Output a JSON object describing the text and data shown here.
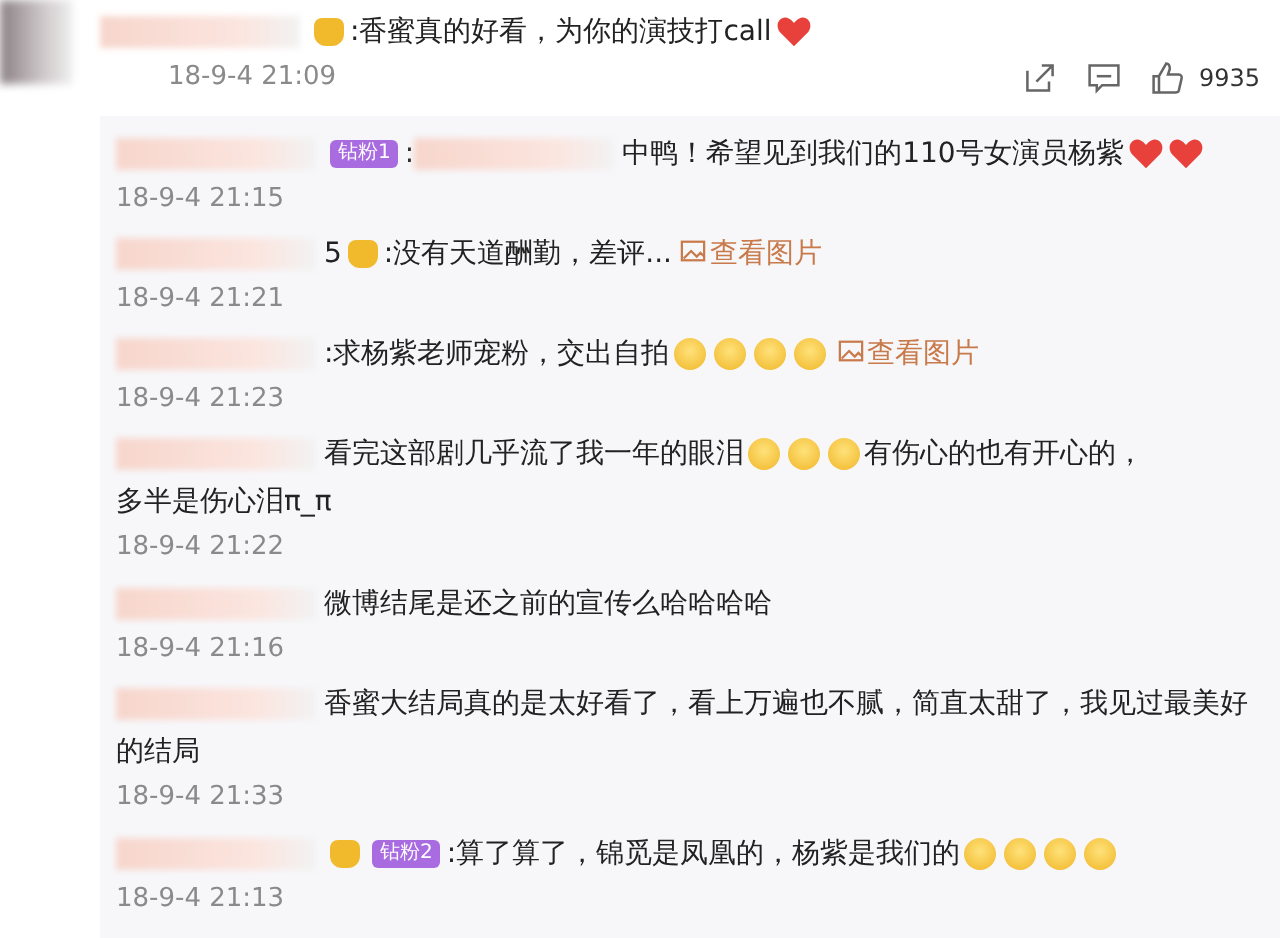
{
  "comment": {
    "segments": [
      {
        "kind": "name"
      },
      {
        "kind": "vip"
      },
      {
        "kind": "text",
        "text": ":香蜜真的好看，为你的演技打call"
      },
      {
        "kind": "heart"
      }
    ],
    "time": "18-9-4 21:09",
    "likes": "9935"
  },
  "replies": [
    {
      "segments": [
        {
          "kind": "name"
        },
        {
          "kind": "badge",
          "text": "钻粉1"
        },
        {
          "kind": "text",
          "text": ":"
        },
        {
          "kind": "name"
        },
        {
          "kind": "text",
          "text": "中鸭！希望见到我们的110号女演员杨紫"
        },
        {
          "kind": "heart"
        },
        {
          "kind": "heart"
        }
      ],
      "time": "18-9-4 21:15"
    },
    {
      "segments": [
        {
          "kind": "name"
        },
        {
          "kind": "text",
          "text": "5"
        },
        {
          "kind": "vip"
        },
        {
          "kind": "text",
          "text": ":没有天道酬勤，差评..."
        },
        {
          "kind": "link",
          "text": "查看图片"
        }
      ],
      "time": "18-9-4 21:21"
    },
    {
      "segments": [
        {
          "kind": "name"
        },
        {
          "kind": "text",
          "text": ":求杨紫老师宠粉，交出自拍"
        },
        {
          "kind": "emoji"
        },
        {
          "kind": "emoji"
        },
        {
          "kind": "emoji"
        },
        {
          "kind": "emoji"
        },
        {
          "kind": "link",
          "text": "查看图片"
        }
      ],
      "time": "18-9-4 21:23"
    },
    {
      "segments": [
        {
          "kind": "name"
        },
        {
          "kind": "text",
          "text": "看完这部剧几乎流了我一年的眼泪"
        },
        {
          "kind": "emoji"
        },
        {
          "kind": "emoji"
        },
        {
          "kind": "emoji"
        },
        {
          "kind": "text",
          "text": "有伤心的也有开心的，"
        },
        {
          "kind": "text",
          "text": "多半是伤心泪π_π"
        }
      ],
      "time": "18-9-4 21:22"
    },
    {
      "segments": [
        {
          "kind": "name"
        },
        {
          "kind": "text",
          "text": "微博结尾是还之前的宣传么哈哈哈哈"
        }
      ],
      "time": "18-9-4 21:16"
    },
    {
      "segments": [
        {
          "kind": "name"
        },
        {
          "kind": "text",
          "text": "香蜜大结局真的是太好看了，看上万遍也不腻，简直太甜了，我见过最美好"
        },
        {
          "kind": "text",
          "text": "的结局"
        }
      ],
      "time": "18-9-4 21:33"
    },
    {
      "segments": [
        {
          "kind": "name"
        },
        {
          "kind": "vip"
        },
        {
          "kind": "badge",
          "text": "钻粉2"
        },
        {
          "kind": "text",
          "text": ":算了算了，锦觅是凤凰的，杨紫是我们的"
        },
        {
          "kind": "emoji"
        },
        {
          "kind": "emoji"
        },
        {
          "kind": "emoji"
        },
        {
          "kind": "emoji"
        }
      ],
      "time": "18-9-4 21:13"
    }
  ]
}
